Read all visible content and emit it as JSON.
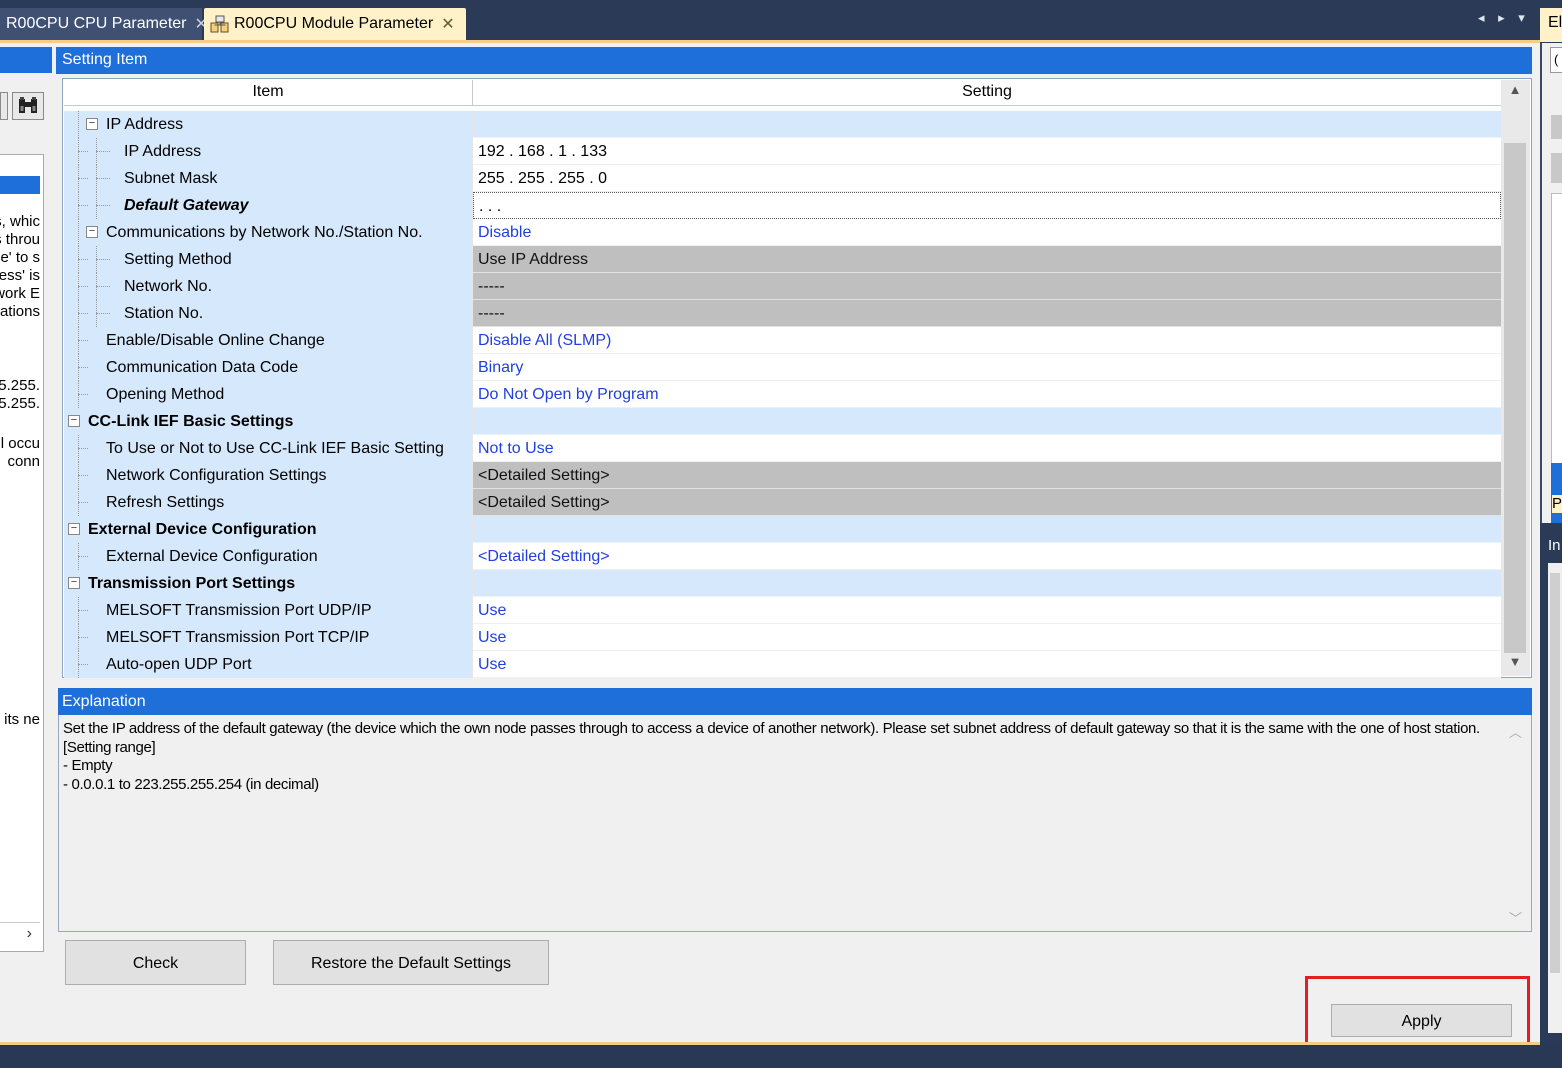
{
  "tabs": [
    {
      "label": "R00CPU CPU Parameter",
      "close": "✕",
      "active": false
    },
    {
      "label": "R00CPU Module Parameter",
      "close": "✕",
      "active": true
    }
  ],
  "tab_nav": "◂ ▸ ▾",
  "right_pane": {
    "stub_label": "El",
    "paren": "(",
    "p_label": "P",
    "in_label": "In"
  },
  "left_panel": {
    "text_lines": [
      "s, whic",
      "s throu",
      "le' to s",
      "ress' is",
      "work E",
      "ations",
      "",
      "5.255.",
      "5.255.",
      "",
      "ill occu",
      "conn",
      "",
      "",
      "",
      "",
      "n its ne"
    ],
    "scroll_right": "›"
  },
  "setting_item": {
    "header": "Setting Item",
    "col_item": "Item",
    "col_setting": "Setting",
    "rows": [
      {
        "level": 1,
        "label": "IP Address",
        "setting": "",
        "expander": "⊟",
        "group": false
      },
      {
        "level": 2,
        "label": "IP Address",
        "setting": "192 . 168 .   1 . 133",
        "style": "plain"
      },
      {
        "level": 2,
        "label": "Subnet Mask",
        "setting": "255 . 255 . 255 .   0",
        "style": "plain"
      },
      {
        "level": 2,
        "label": "Default Gateway",
        "setting": "  .     .     .",
        "style": "focused",
        "emph": true
      },
      {
        "level": 1,
        "label": "Communications by Network No./Station No.",
        "setting": "Disable",
        "expander": "⊟",
        "style": "link"
      },
      {
        "level": 2,
        "label": "Setting Method",
        "setting": "Use IP Address",
        "style": "gray"
      },
      {
        "level": 2,
        "label": "Network No.",
        "setting": "-----",
        "style": "gray"
      },
      {
        "level": 2,
        "label": "Station No.",
        "setting": "-----",
        "style": "gray"
      },
      {
        "level": 1,
        "label": "Enable/Disable Online Change",
        "setting": "Disable All (SLMP)",
        "style": "link"
      },
      {
        "level": 1,
        "label": "Communication Data Code",
        "setting": "Binary",
        "style": "link"
      },
      {
        "level": 1,
        "label": "Opening Method",
        "setting": "Do Not Open by Program",
        "style": "link"
      },
      {
        "level": 0,
        "label": "CC-Link IEF Basic Settings",
        "setting": "",
        "expander": "⊟",
        "group": true
      },
      {
        "level": 1,
        "label": "To Use or Not to Use CC-Link IEF Basic Setting",
        "setting": "Not to Use",
        "style": "link"
      },
      {
        "level": 1,
        "label": "Network Configuration Settings",
        "setting": "<Detailed Setting>",
        "style": "gray"
      },
      {
        "level": 1,
        "label": "Refresh Settings",
        "setting": "<Detailed Setting>",
        "style": "gray"
      },
      {
        "level": 0,
        "label": "External Device Configuration",
        "setting": "",
        "expander": "⊟",
        "group": true
      },
      {
        "level": 1,
        "label": "External Device Configuration",
        "setting": "<Detailed Setting>",
        "style": "link"
      },
      {
        "level": 0,
        "label": "Transmission Port Settings",
        "setting": "",
        "expander": "⊟",
        "group": true
      },
      {
        "level": 1,
        "label": "MELSOFT Transmission Port UDP/IP",
        "setting": "Use",
        "style": "link"
      },
      {
        "level": 1,
        "label": "MELSOFT Transmission Port TCP/IP",
        "setting": "Use",
        "style": "link"
      },
      {
        "level": 1,
        "label": "Auto-open UDP Port",
        "setting": "Use",
        "style": "link"
      }
    ],
    "scroll_up": "▲",
    "scroll_down": "▼"
  },
  "explanation": {
    "header": "Explanation",
    "lines": [
      "Set the IP address of the default gateway (the device which the own node passes through to access a device of another network). Please set subnet address of default gateway so that it is the same with the one of host station.",
      "[Setting range]",
      "- Empty",
      "- 0.0.0.1 to 223.255.255.254 (in decimal)"
    ],
    "scroll_up": "︿",
    "scroll_down": "﹀"
  },
  "buttons": {
    "check": "Check",
    "restore": "Restore the Default Settings",
    "apply": "Apply"
  },
  "colors": {
    "header_blue": "#1e6fd9",
    "item_bg": "#d6e8fb",
    "link_blue": "#1f3fe0",
    "gray_cell": "#bfbfbf",
    "highlight_red": "#e02020",
    "tab_active": "#fff2c8",
    "frame_navy": "#293955"
  }
}
